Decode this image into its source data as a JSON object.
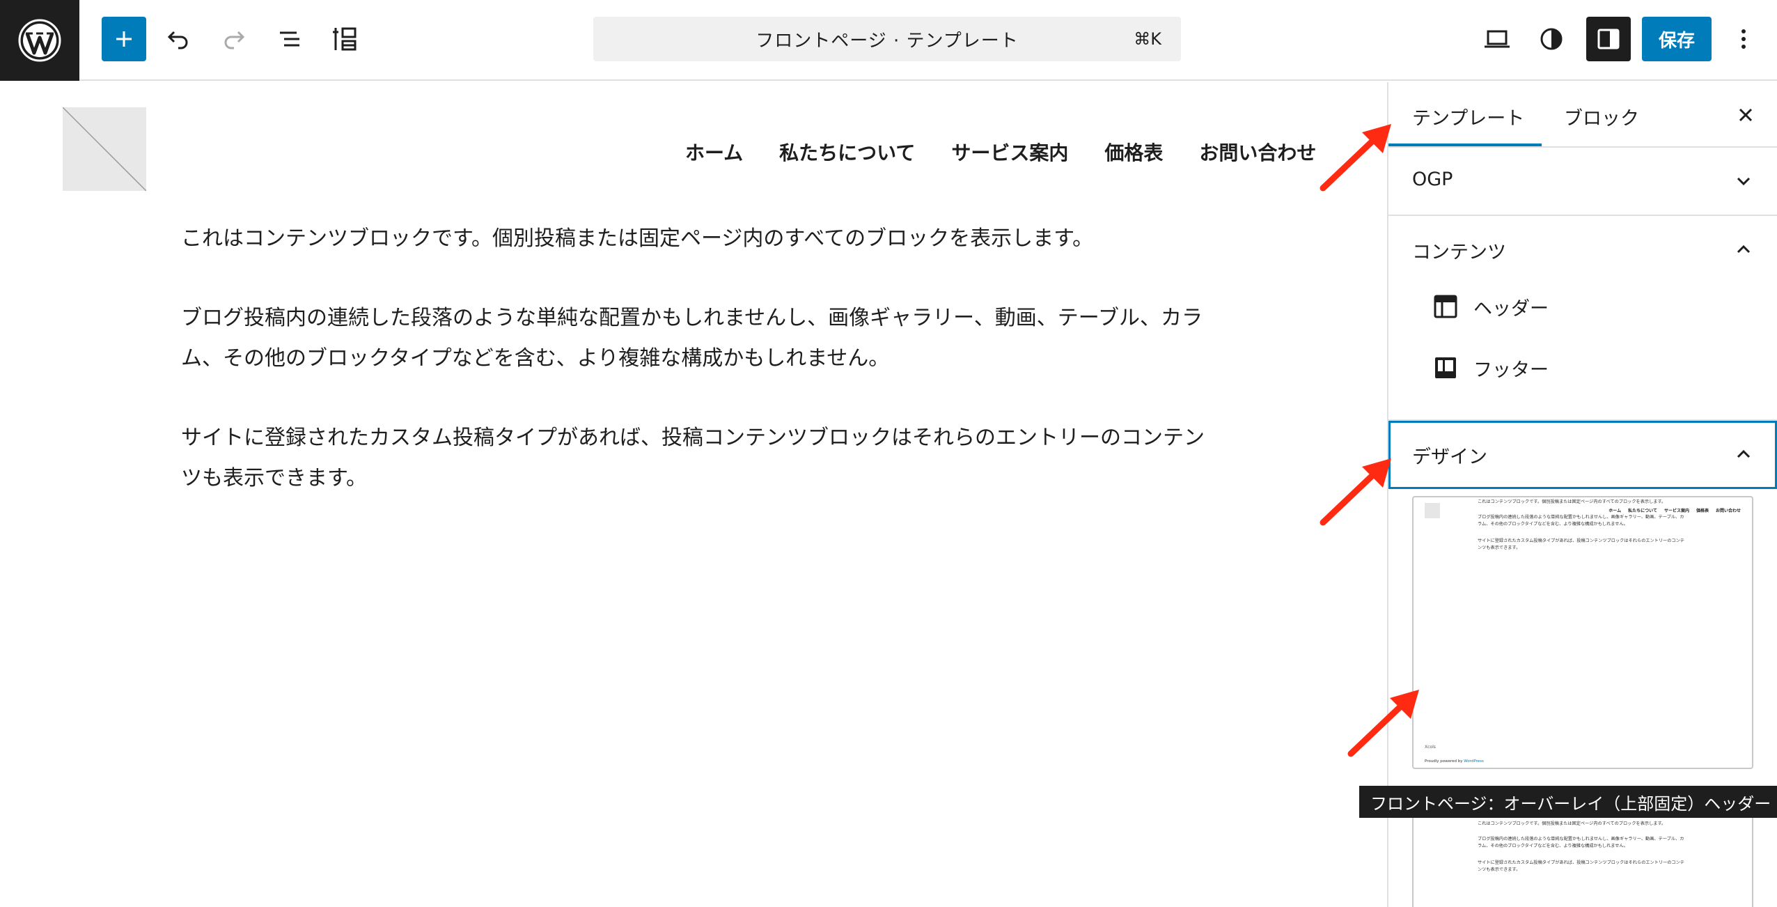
{
  "toolbar": {
    "add_label": "+",
    "save_label": "保存",
    "command_title": "フロントページ · テンプレート",
    "command_shortcut": "⌘K"
  },
  "canvas": {
    "nav": [
      "ホーム",
      "私たちについて",
      "サービス案内",
      "価格表",
      "お問い合わせ"
    ],
    "paragraphs": [
      "これはコンテンツブロックです。個別投稿または固定ページ内のすべてのブロックを表示します。",
      "ブログ投稿内の連続した段落のような単純な配置かもしれませんし、画像ギャラリー、動画、テーブル、カラム、その他のブロックタイプなどを含む、より複雑な構成かもしれません。",
      "サイトに登録されたカスタム投稿タイプがあれば、投稿コンテンツブロックはそれらのエントリーのコンテンツも表示できます。"
    ]
  },
  "sidebar": {
    "tabs": [
      "テンプレート",
      "ブロック"
    ],
    "active_tab": "テンプレート",
    "panels": {
      "ogp": "OGP",
      "contents": "コンテンツ",
      "design": "デザイン"
    },
    "template_parts": [
      "ヘッダー",
      "フッター"
    ],
    "preview": {
      "footer_site": "Xcols",
      "footer_powered": "Proudly powered by ",
      "footer_link": "WordPress"
    },
    "tooltip": "フロントページ：オーバーレイ（上部固定）ヘッダー"
  },
  "colors": {
    "accent": "#007cba",
    "dark": "#1e1e1e",
    "annotation_arrow": "#ff2a12"
  }
}
